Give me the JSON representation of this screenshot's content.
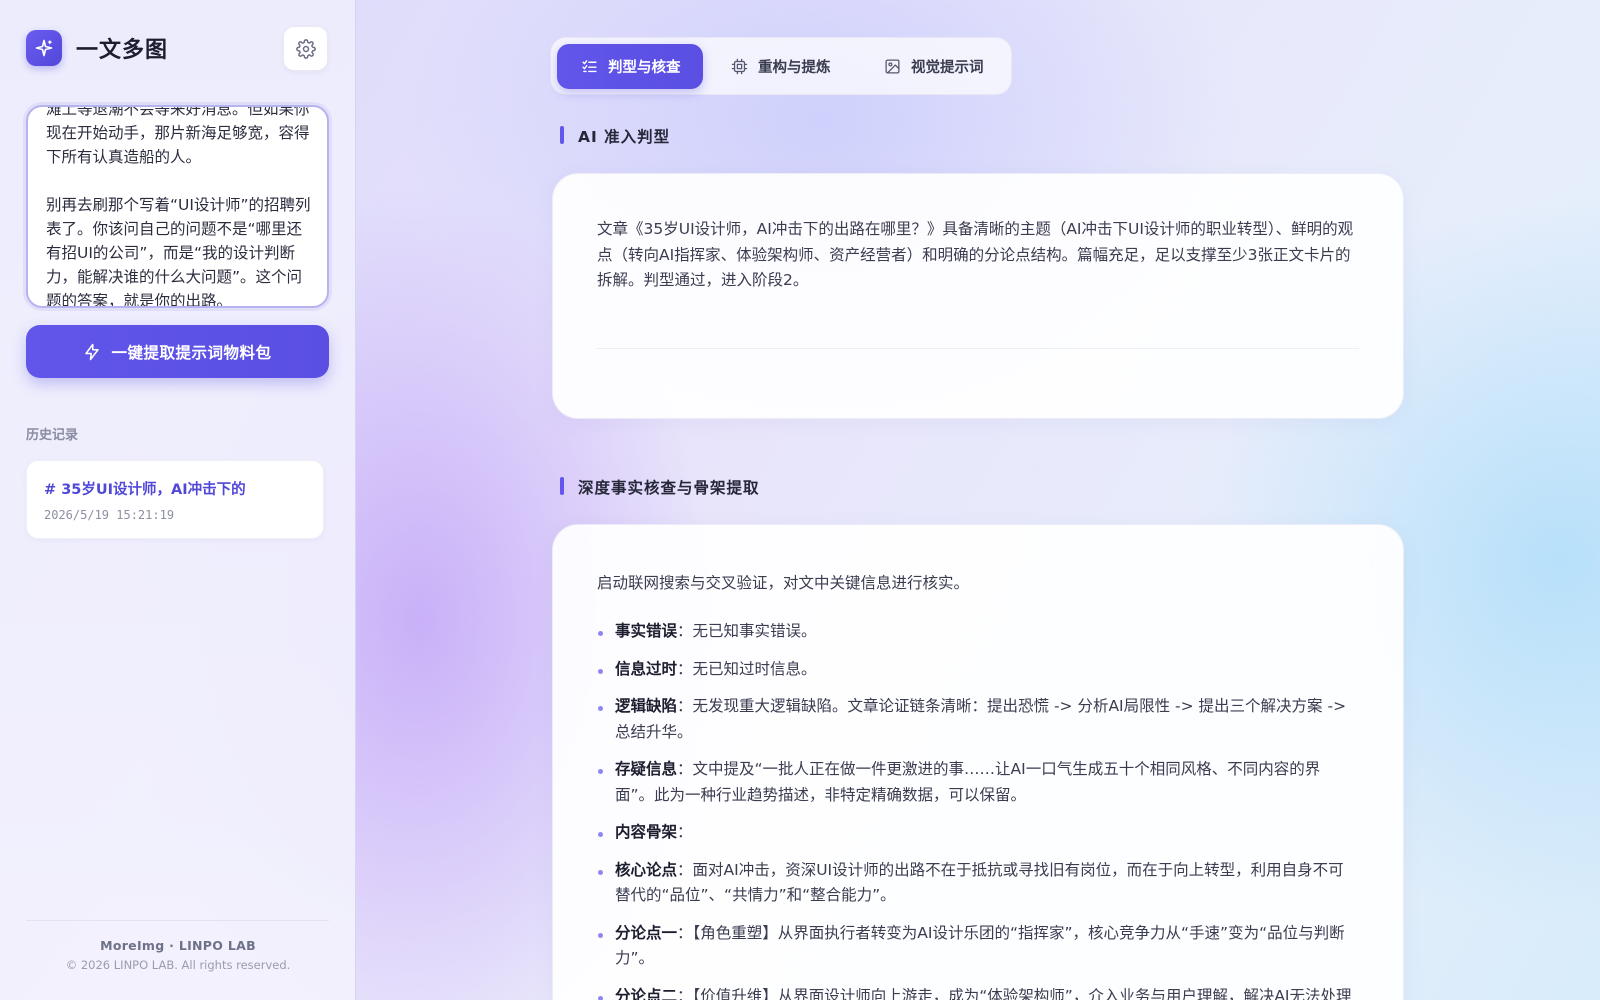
{
  "app": {
    "name": "一文多图"
  },
  "sidebar": {
    "input_text": "滩上等退潮不会等来好消息。但如果你现在开始动手，那片新海足够宽，容得下所有认真造船的人。\n\n别再去刷那个写着“UI设计师”的招聘列表了。你该问自己的问题不是“哪里还有招UI的公司”，而是“我的设计判断力，能解决谁的什么大问题”。这个问题的答案，就是你的出路。",
    "extract_button": "一键提取提示词物料包",
    "history_title": "历史记录",
    "history": [
      {
        "title": "# 35岁UI设计师，AI冲击下的",
        "time": "2026/5/19 15:21:19"
      }
    ],
    "footer_brand": "MoreImg · LINPO LAB",
    "footer_copy": "© 2026 LINPO LAB. All rights reserved."
  },
  "tabs": [
    {
      "label": "判型与核查",
      "icon": "checklist-icon",
      "active": true
    },
    {
      "label": "重构与提炼",
      "icon": "cpu-icon",
      "active": false
    },
    {
      "label": "视觉提示词",
      "icon": "image-icon",
      "active": false
    }
  ],
  "sections": {
    "judge": {
      "title": "AI 准入判型",
      "text": "文章《35岁UI设计师，AI冲击下的出路在哪里？》具备清晰的主题（AI冲击下UI设计师的职业转型）、鲜明的观点（转向AI指挥家、体验架构师、资产经营者）和明确的分论点结构。篇幅充足，足以支撑至少3张正文卡片的拆解。判型通过，进入阶段2。"
    },
    "factcheck": {
      "title": "深度事实核查与骨架提取",
      "intro": "启动联网搜索与交叉验证，对文中关键信息进行核实。",
      "items": [
        {
          "key": "事实错误",
          "value": "：无已知事实错误。"
        },
        {
          "key": "信息过时",
          "value": "：无已知过时信息。"
        },
        {
          "key": "逻辑缺陷",
          "value": "：无发现重大逻辑缺陷。文章论证链条清晰：提出恐慌 -> 分析AI局限性 -> 提出三个解决方案 -> 总结升华。"
        },
        {
          "key": "存疑信息",
          "value": "：文中提及“一批人正在做一件更激进的事……让AI一口气生成五十个相同风格、不同内容的界面”。此为一种行业趋势描述，非特定精确数据，可以保留。"
        },
        {
          "key": "内容骨架",
          "value": "："
        },
        {
          "key": "核心论点",
          "value": "：面对AI冲击，资深UI设计师的出路不在于抵抗或寻找旧有岗位，而在于向上转型，利用自身不可替代的“品位”、“共情力”和“整合能力”。"
        },
        {
          "key": "分论点一",
          "value": "：【角色重塑】从界面执行者转变为AI设计乐团的“指挥家”，核心竞争力从“手速”变为“品位与判断力”。"
        },
        {
          "key": "分论点二",
          "value": "：【价值升维】从界面设计师向上游走，成为“体验架构师”，介入业务与用户理解，解决AI无法处理的问题。"
        }
      ]
    }
  },
  "colors": {
    "accent": "#5a4fe2",
    "accent_light": "#b6b4ef"
  }
}
